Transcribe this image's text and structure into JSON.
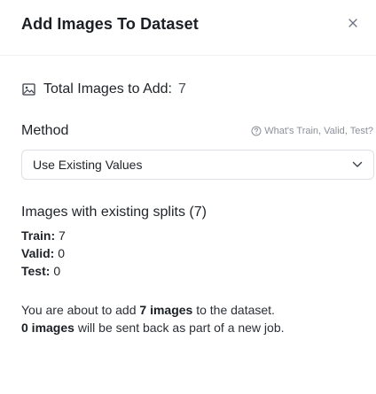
{
  "dialog": {
    "title": "Add Images To Dataset",
    "close_icon": "close-icon"
  },
  "total": {
    "icon": "image-icon",
    "label": "Total Images to Add:",
    "value": "7"
  },
  "method": {
    "label": "Method",
    "help_icon": "question-circle-icon",
    "help_text": "What's Train, Valid, Test?",
    "select_value": "Use Existing Values",
    "chevron_icon": "chevron-down-icon"
  },
  "splits": {
    "title": "Images with existing splits (7)",
    "items": [
      {
        "label": "Train:",
        "value": "7"
      },
      {
        "label": "Valid:",
        "value": "0"
      },
      {
        "label": "Test:",
        "value": "0"
      }
    ]
  },
  "summary": {
    "line1_prefix": "You are about to add ",
    "line1_bold": "7 images",
    "line1_suffix": " to the dataset.",
    "line2_bold": "0 images",
    "line2_suffix": " will be sent back as part of a new job."
  },
  "colors": {
    "text": "#1f2328",
    "muted": "#8a9099",
    "border": "#dde1e6"
  }
}
